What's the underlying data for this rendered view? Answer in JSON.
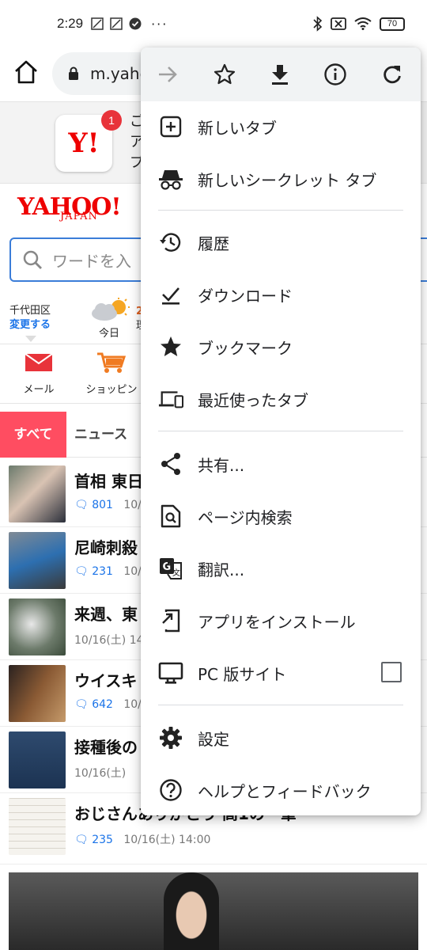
{
  "status_bar": {
    "time": "2:29",
    "battery": "70",
    "more": "···"
  },
  "url_bar": {
    "url": "m.yahoo.co.jp"
  },
  "page": {
    "notice_line1": "ご",
    "notice_line2": "ア",
    "notice_line3": "プ",
    "badge_count": "1",
    "y_icon_text": "Y!",
    "logo_text": "YAHOO!",
    "logo_sub": "JAPAN",
    "search_placeholder": "ワードを入",
    "location": "千代田区",
    "location_change": "変更する",
    "weather_label": "今日",
    "weather_temp": "2",
    "weather_sub": "理",
    "quick_items": [
      "メール",
      "ショッピン"
    ],
    "tab_all": "すべて",
    "tab_news": "ニュース",
    "news": [
      {
        "title": "首相 東日",
        "comments": "801",
        "date": "10/1"
      },
      {
        "title": "尼崎刺殺",
        "comments": "231",
        "date": "10/1"
      },
      {
        "title": "来週、東",
        "comments": "",
        "date": "10/16(土) 14"
      },
      {
        "title": "ウイスキ",
        "comments": "642",
        "date": "10/1"
      },
      {
        "title": "接種後の",
        "comments": "",
        "date": "10/16(土)"
      },
      {
        "title": "おじさんありがとう 高1の一筆",
        "comments": "235",
        "date": "10/16(土) 14:00"
      }
    ]
  },
  "menu": {
    "toolbar": [
      "forward-icon",
      "bookmark-star-icon",
      "download-icon",
      "info-icon",
      "reload-icon"
    ],
    "items": [
      {
        "label": "新しいタブ",
        "icon": "new-tab-icon"
      },
      {
        "label": "新しいシークレット タブ",
        "icon": "incognito-icon"
      },
      {
        "label": "履歴",
        "icon": "history-icon"
      },
      {
        "label": "ダウンロード",
        "icon": "downloads-icon"
      },
      {
        "label": "ブックマーク",
        "icon": "bookmarks-icon"
      },
      {
        "label": "最近使ったタブ",
        "icon": "recent-tabs-icon"
      },
      {
        "label": "共有...",
        "icon": "share-icon"
      },
      {
        "label": "ページ内検索",
        "icon": "find-in-page-icon"
      },
      {
        "label": "翻訳...",
        "icon": "translate-icon"
      },
      {
        "label": "アプリをインストール",
        "icon": "install-app-icon"
      },
      {
        "label": "PC 版サイト",
        "icon": "desktop-site-icon",
        "checked": false
      },
      {
        "label": "設定",
        "icon": "settings-icon"
      },
      {
        "label": "ヘルプとフィードバック",
        "icon": "help-icon"
      }
    ]
  },
  "colors": {
    "accent_red": "#ff4d61",
    "link_blue": "#1a73e8",
    "yahoo_red": "#e00000",
    "menu_toolbar_bg": "#f1f3f4"
  }
}
